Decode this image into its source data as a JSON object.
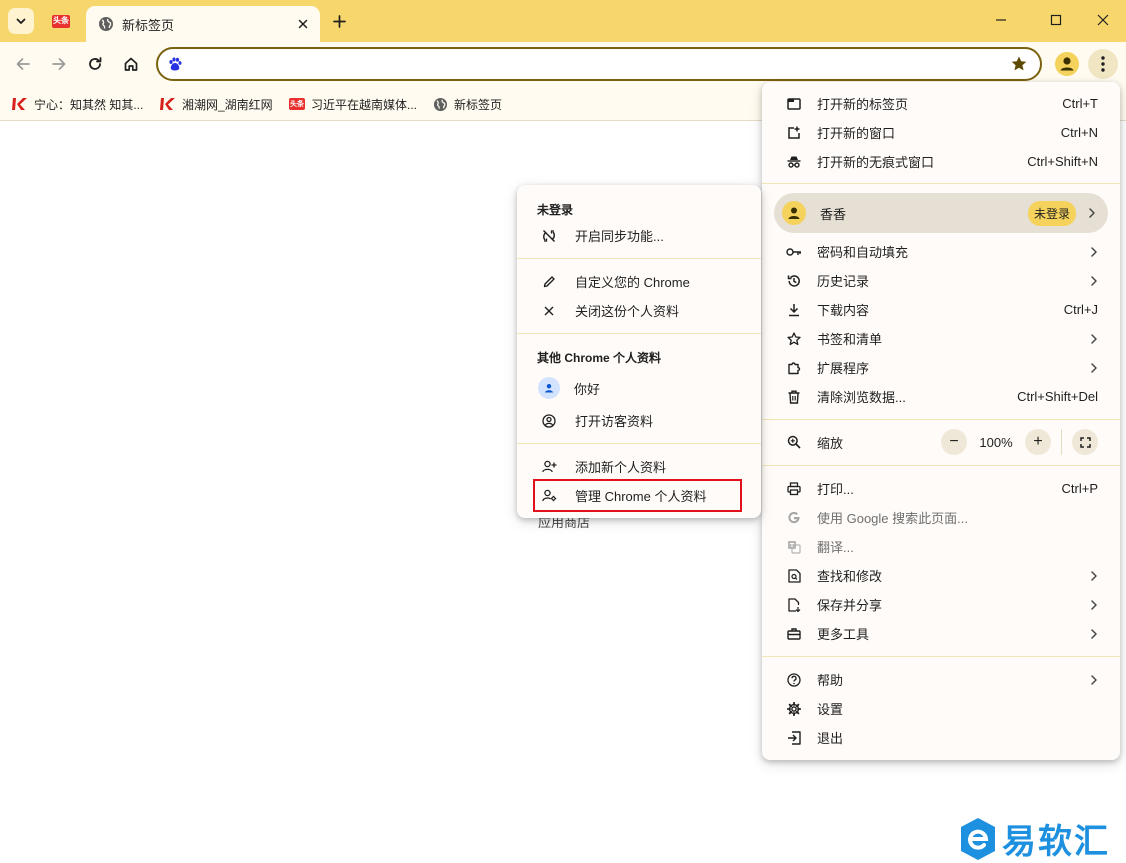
{
  "tabs": {
    "pinned_tab_icon": "toutiao-favicon",
    "pinned_tab_icon_text": "头条",
    "active_tab_title": "新标签页"
  },
  "omnibox": {
    "value": "",
    "placeholder": ""
  },
  "bookmarks": [
    {
      "label": "宁心：知其然 知其...",
      "icon": "red-k-favicon"
    },
    {
      "label": "湘潮网_湖南红网",
      "icon": "red-k-favicon"
    },
    {
      "label": "习近平在越南媒体...",
      "icon": "toutiao-favicon",
      "icon_text": "头条"
    },
    {
      "label": "新标签页",
      "icon": "globe-icon"
    }
  ],
  "page": {
    "apps_text": "应用商店"
  },
  "main_menu": {
    "new_tab": {
      "label": "打开新的标签页",
      "shortcut": "Ctrl+T"
    },
    "new_window": {
      "label": "打开新的窗口",
      "shortcut": "Ctrl+N"
    },
    "new_incognito": {
      "label": "打开新的无痕式窗口",
      "shortcut": "Ctrl+Shift+N"
    },
    "profile": {
      "name": "香香",
      "badge": "未登录"
    },
    "passwords": {
      "label": "密码和自动填充"
    },
    "history": {
      "label": "历史记录"
    },
    "downloads": {
      "label": "下载内容",
      "shortcut": "Ctrl+J"
    },
    "bookmarks": {
      "label": "书签和清单"
    },
    "extensions": {
      "label": "扩展程序"
    },
    "clear_data": {
      "label": "清除浏览数据...",
      "shortcut": "Ctrl+Shift+Del"
    },
    "zoom": {
      "label": "缩放",
      "minus": "−",
      "value": "100%",
      "plus": "+"
    },
    "print": {
      "label": "打印...",
      "shortcut": "Ctrl+P"
    },
    "search_google": {
      "label": "使用 Google 搜索此页面..."
    },
    "translate": {
      "label": "翻译..."
    },
    "find_edit": {
      "label": "查找和修改"
    },
    "save_share": {
      "label": "保存并分享"
    },
    "more_tools": {
      "label": "更多工具"
    },
    "help": {
      "label": "帮助"
    },
    "settings": {
      "label": "设置"
    },
    "exit": {
      "label": "退出"
    }
  },
  "profile_submenu": {
    "status_heading": "未登录",
    "turn_on_sync": "开启同步功能...",
    "customize": "自定义您的 Chrome",
    "close_profile": "关闭这份个人资料",
    "other_profiles_heading": "其他 Chrome 个人资料",
    "other_profile_name": "你好",
    "guest": "打开访客资料",
    "add_profile": "添加新个人资料",
    "manage_profiles": "管理 Chrome 个人资料"
  },
  "watermark": {
    "text": "易软汇"
  },
  "colors": {
    "tabstrip": "#f7d66b",
    "toolbar": "#fffbf0",
    "accent_yellow": "#f4d25c",
    "highlight_red": "#e0111a",
    "watermark_blue": "#1e90e0"
  }
}
